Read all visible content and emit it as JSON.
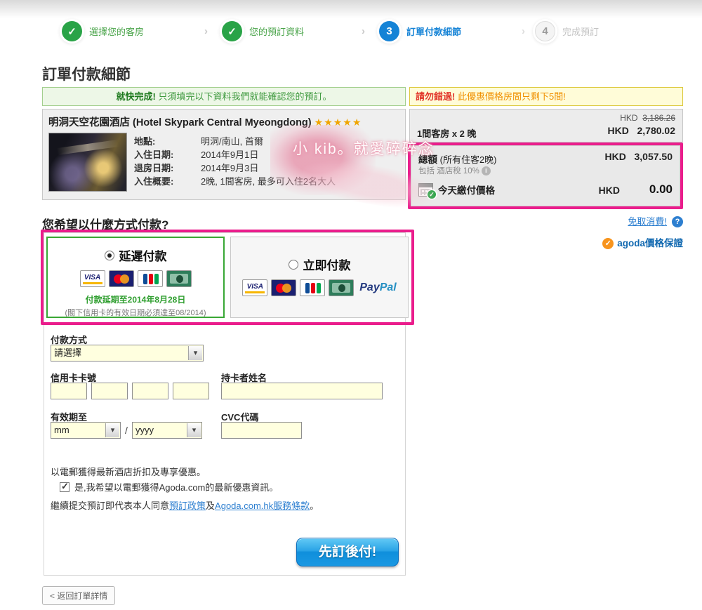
{
  "steps": {
    "chevron": "›",
    "s1": {
      "label": "選擇您的客房"
    },
    "s2": {
      "label": "您的預訂資料"
    },
    "s3": {
      "num": "3",
      "label": "訂單付款細節"
    },
    "s4": {
      "num": "4",
      "label": "完成預訂"
    }
  },
  "page_title": "訂單付款細節",
  "banners": {
    "green_bold": "就快完成!",
    "green_rest": "只須填完以下資料我們就能確認您的預訂。",
    "yellow_bold": "請勿錯過!",
    "yellow_rest": "此優惠價格房間只剩下5間!"
  },
  "hotel": {
    "name": "明洞天空花園酒店 (Hotel Skypark Central Myeongdong)",
    "stars": "★★★★★",
    "rows": {
      "r1": {
        "label": "地點:",
        "value": "明洞/南山, 首爾"
      },
      "r2": {
        "label": "入住日期:",
        "value": "2014年9月1日"
      },
      "r3": {
        "label": "退房日期:",
        "value": "2014年9月3日"
      },
      "r4": {
        "label": "入住概要:",
        "value": "2晚, 1間客房, 最多可入住2名大人"
      }
    }
  },
  "price": {
    "currency": "HKD",
    "old_price": "3,186.26",
    "room_line": "1間客房 x 2 晚",
    "room_price": "2,780.02",
    "total_label": "總額",
    "total_sub": "(所有住客2晚)",
    "tax_note": "包括 酒店稅 10%",
    "info_glyph": "i",
    "total_price": "3,057.50",
    "today_label": "今天繳付價格",
    "today_price": "0.00"
  },
  "links": {
    "free_cancel": "免取消費!",
    "question_glyph": "?",
    "check_glyph": "✓",
    "guarantee": "agoda價格保證"
  },
  "payment": {
    "question": "您希望以什麼方式付款?",
    "later_label": "延遲付款",
    "now_label": "立即付款",
    "later_note_green": "付款延期至2014年8月28日",
    "later_note_gray": "(閣下信用卡的有效日期必須達至08/2014)",
    "paypal_1": "Pay",
    "paypal_2": "Pal",
    "cards": [
      "visa",
      "mastercard",
      "jcb",
      "amex"
    ]
  },
  "form": {
    "method_label": "付款方式",
    "method_value": "請選擇",
    "ddl_glyph": "▾",
    "card_number_label": "信用卡卡號",
    "holder_label": "持卡者姓名",
    "expiry_label": "有效期至",
    "expiry_mm": "mm",
    "expiry_sep": "/",
    "expiry_yyyy": "yyyy",
    "cvc_label": "CVC代碼",
    "email_promo": "以電郵獲得最新酒店折扣及專享優惠。",
    "email_optin": "是,我希望以電郵獲得Agoda.com的最新優惠資訊。",
    "terms_prefix": "繼續提交預訂即代表本人同意",
    "terms_link1": "預訂政策",
    "terms_mid": "及",
    "terms_link2": "Agoda.com.hk服務條款",
    "terms_suffix": "。",
    "submit_label": "先訂後付!"
  },
  "back_button": "< 返回訂單詳情",
  "watermark": "小 kib。就愛碎碎念",
  "colors": {
    "step_green": "#29a347",
    "step_blue": "#1583d6",
    "annotation_pink": "#ea1d8c",
    "button_blue": "#0f8fdc",
    "link_blue": "#2d7fd0",
    "input_yellow": "#ffffdf"
  }
}
